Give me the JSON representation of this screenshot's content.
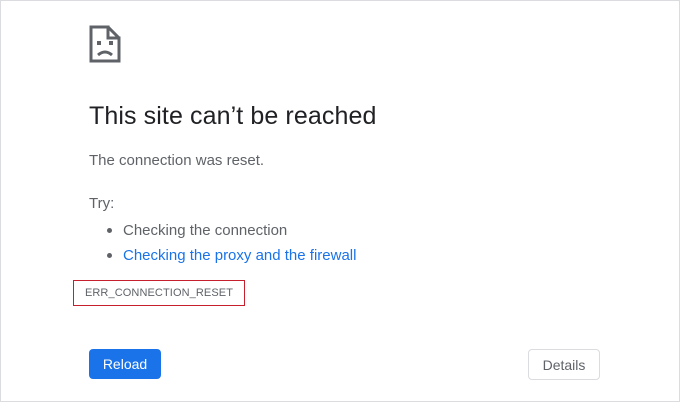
{
  "error_page": {
    "icon": "sad-page-icon",
    "title": "This site can’t be reached",
    "subtitle": "The connection was reset.",
    "try_label": "Try:",
    "suggestions": [
      {
        "text": "Checking the connection",
        "is_link": false
      },
      {
        "text": "Checking the proxy and the firewall",
        "is_link": true
      }
    ],
    "error_code": "ERR_CONNECTION_RESET"
  },
  "buttons": {
    "reload_label": "Reload",
    "details_label": "Details"
  },
  "colors": {
    "accent": "#1a73e8",
    "text_primary": "#202124",
    "text_secondary": "#5f6368",
    "error_code_border": "#c6202f"
  }
}
